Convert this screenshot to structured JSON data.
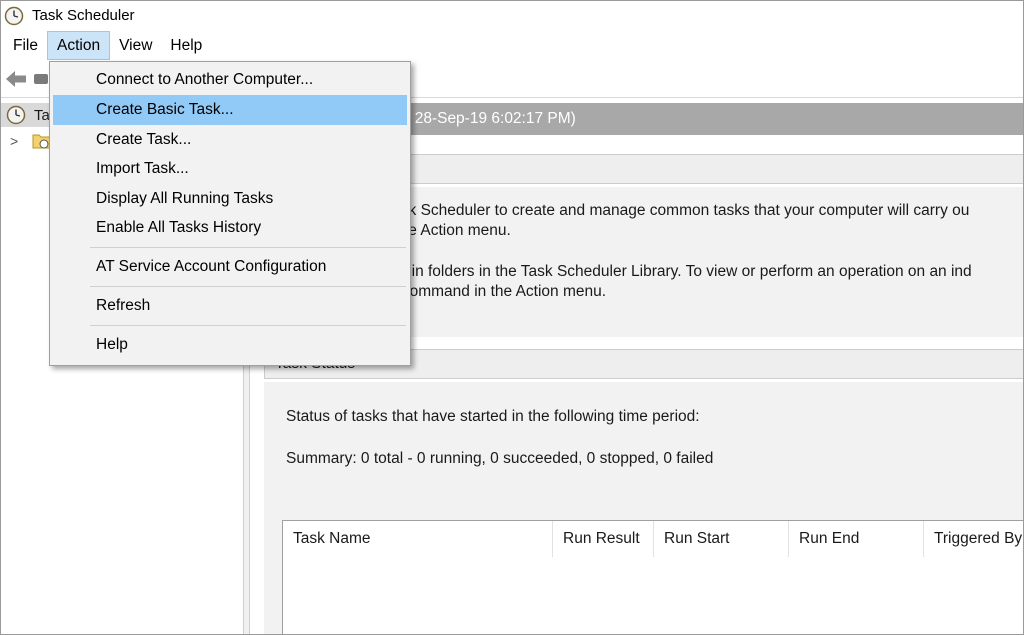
{
  "window": {
    "title": "Task Scheduler",
    "icon": "clock-icon"
  },
  "menubar": {
    "items": [
      "File",
      "Action",
      "View",
      "Help"
    ],
    "active": "Action"
  },
  "toolbar": {
    "back_icon": "back-arrow-icon",
    "forward_icon": "forward-icon"
  },
  "tree": {
    "root_label": "Ta",
    "root_icon": "clock-icon",
    "child_expander": ">",
    "child_icon": "folder-clock-icon"
  },
  "action_menu": {
    "items": [
      {
        "label": "Connect to Another Computer...",
        "highlighted": false
      },
      {
        "label": "Create Basic Task...",
        "highlighted": true
      },
      {
        "label": "Create Task...",
        "highlighted": false
      },
      {
        "label": "Import Task...",
        "highlighted": false
      },
      {
        "label": "Display All Running Tasks",
        "highlighted": false
      },
      {
        "label": "Enable All Tasks History",
        "highlighted": false
      },
      {
        "label": "AT Service Account Configuration",
        "highlighted": false
      },
      {
        "label": "Refresh",
        "highlighted": false
      },
      {
        "label": "Help",
        "highlighted": false
      }
    ],
    "highlight_color": "#91c9f7"
  },
  "content": {
    "summary_bar": "ary (Last refreshed: 28-Sep-19 6:02:17 PM)",
    "overview_header": "cheduler",
    "overview_lines": [
      "se Task Scheduler to create and manage common tasks that your computer will carry ou",
      "in the Action menu.",
      "tored in folders in the Task Scheduler Library. To view or perform an operation on an ind",
      "n a command in the Action menu."
    ],
    "status_header": "Task Status",
    "status_period": "Status of tasks that have started in the following time period:",
    "status_summary": "Summary: 0 total - 0 running, 0 succeeded, 0 stopped, 0 failed",
    "table_columns": [
      "Task Name",
      "Run Result",
      "Run Start",
      "Run End",
      "Triggered By"
    ]
  }
}
